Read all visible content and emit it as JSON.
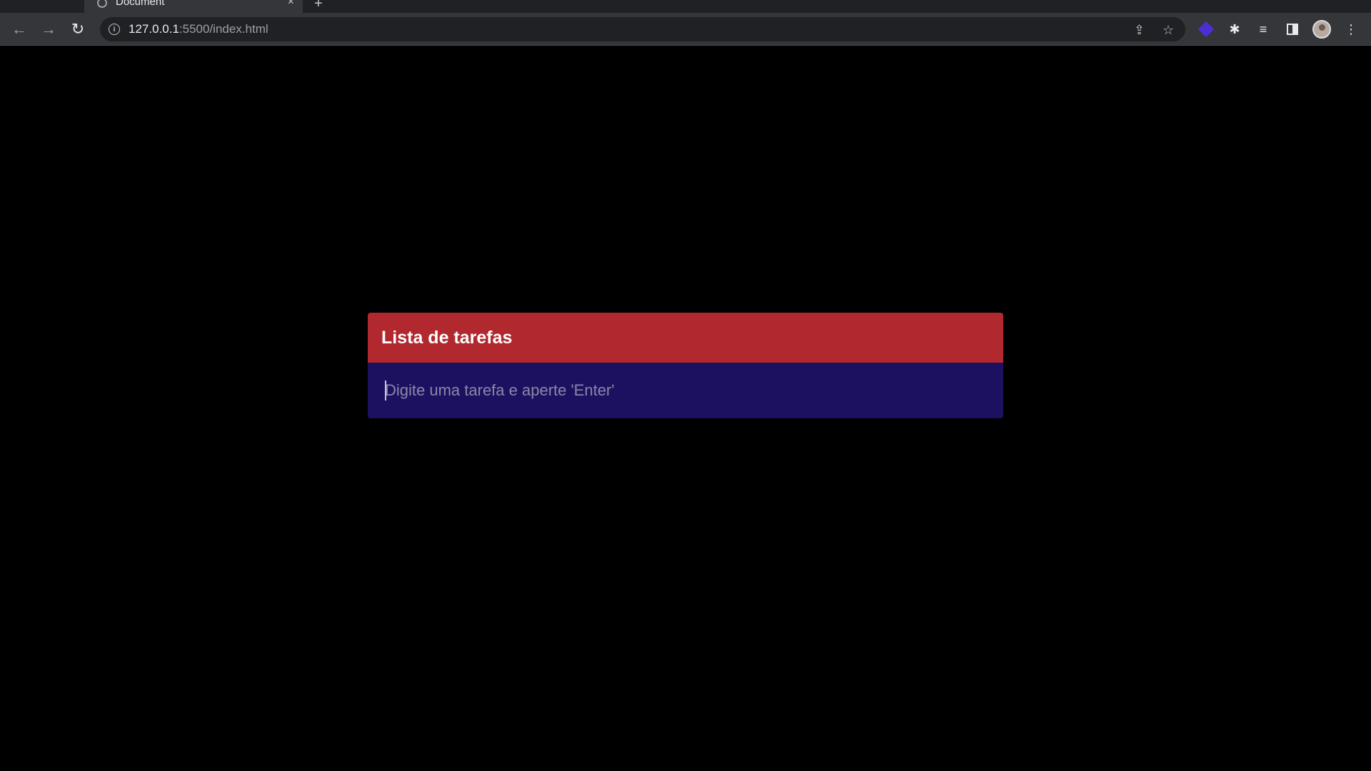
{
  "browser": {
    "tab": {
      "title": "Document",
      "close_glyph": "×",
      "favicon": "globe-icon"
    },
    "new_tab_glyph": "+",
    "address_bar": {
      "host": "127.0.0.1",
      "rest": ":5500/index.html"
    },
    "icons": {
      "back": "←",
      "forward": "→",
      "reload": "↻",
      "share": "⇪",
      "bookmark": "☆",
      "extensions": "✱",
      "reading_list": "≡",
      "menu": "⋮"
    },
    "colors": {
      "tabstrip": "#202124",
      "toolbar": "#35363a",
      "extension_accent": "#4b2fd1"
    }
  },
  "todo": {
    "title": "Lista de tarefas",
    "input_placeholder": "Digite uma tarefa e aperte 'Enter'",
    "input_value": "",
    "colors": {
      "header": "#b1282e",
      "input_bg": "#1c1160",
      "page_bg": "#000000"
    }
  }
}
